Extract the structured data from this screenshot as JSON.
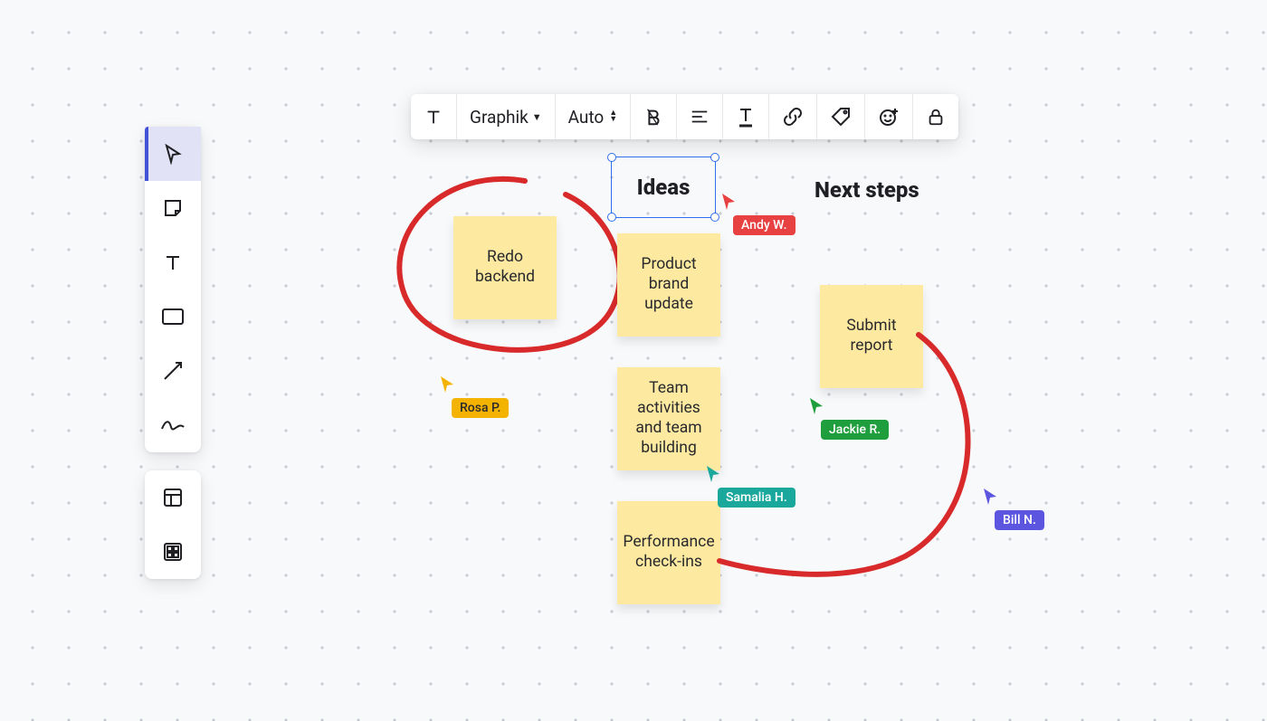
{
  "sidebar": {
    "tools": [
      {
        "name": "select",
        "selected": true
      },
      {
        "name": "sticky-note",
        "selected": false
      },
      {
        "name": "text",
        "selected": false
      },
      {
        "name": "shape",
        "selected": false
      },
      {
        "name": "connector",
        "selected": false
      },
      {
        "name": "pen",
        "selected": false
      }
    ],
    "panel2": [
      {
        "name": "layout-template",
        "selected": false
      },
      {
        "name": "widget-grid",
        "selected": false
      }
    ]
  },
  "context_toolbar": {
    "font_family": "Graphik",
    "size_mode": "Auto"
  },
  "headings": {
    "ideas": "Ideas",
    "next_steps": "Next steps"
  },
  "notes": {
    "col1": [
      {
        "text": "Redo backend"
      }
    ],
    "col2": [
      {
        "text": "Product brand update"
      },
      {
        "text": "Team activities and team building"
      },
      {
        "text": "Performance check-ins"
      }
    ],
    "col3": [
      {
        "text": "Submit report"
      }
    ]
  },
  "cursors": {
    "andy": {
      "label": "Andy W.",
      "color": "#e84141"
    },
    "rosa": {
      "label": "Rosa P.",
      "color": "#f5b301"
    },
    "samalia": {
      "label": "Samalia H.",
      "color": "#1aa79c"
    },
    "jackie": {
      "label": "Jackie R.",
      "color": "#1f9e3d"
    },
    "bill": {
      "label": "Bill N.",
      "color": "#5b55e0"
    }
  },
  "colors": {
    "ink": "#d82a2a",
    "note": "#fdeaa0",
    "select_blue": "#2f6fed",
    "sidebar_accent": "#4252d6"
  }
}
